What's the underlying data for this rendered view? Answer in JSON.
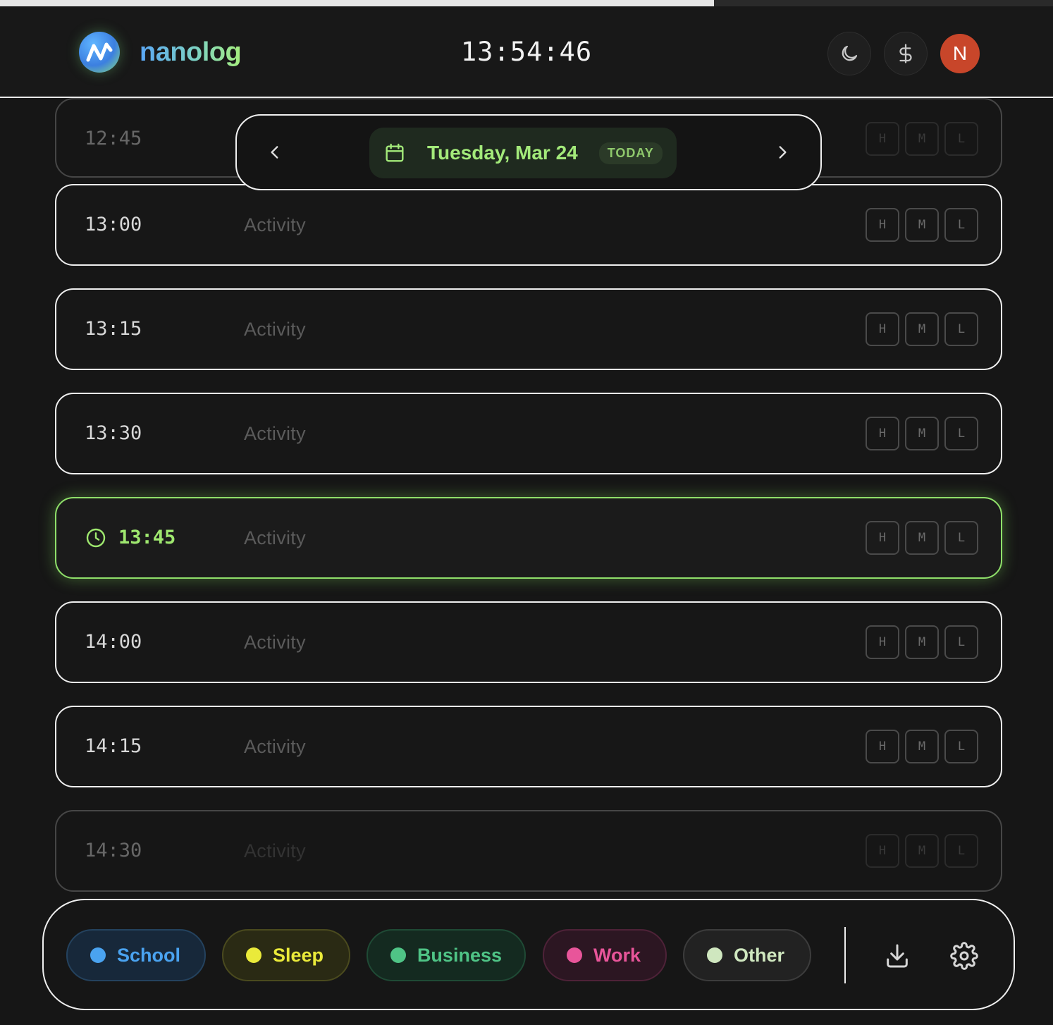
{
  "progress": {
    "fraction": 0.678
  },
  "header": {
    "brand": "nanolog",
    "clock": "13:54:46",
    "avatar_initial": "N"
  },
  "date_nav": {
    "date": "Tuesday, Mar 24",
    "badge": "TODAY"
  },
  "slots": [
    {
      "time": "12:45",
      "activity": "Activity",
      "levels": [
        "H",
        "M",
        "L"
      ],
      "state": "faded"
    },
    {
      "time": "13:00",
      "activity": "Activity",
      "levels": [
        "H",
        "M",
        "L"
      ],
      "state": "normal"
    },
    {
      "time": "13:15",
      "activity": "Activity",
      "levels": [
        "H",
        "M",
        "L"
      ],
      "state": "normal"
    },
    {
      "time": "13:30",
      "activity": "Activity",
      "levels": [
        "H",
        "M",
        "L"
      ],
      "state": "normal"
    },
    {
      "time": "13:45",
      "activity": "Activity",
      "levels": [
        "H",
        "M",
        "L"
      ],
      "state": "current"
    },
    {
      "time": "14:00",
      "activity": "Activity",
      "levels": [
        "H",
        "M",
        "L"
      ],
      "state": "normal"
    },
    {
      "time": "14:15",
      "activity": "Activity",
      "levels": [
        "H",
        "M",
        "L"
      ],
      "state": "normal"
    },
    {
      "time": "14:30",
      "activity": "Activity",
      "levels": [
        "H",
        "M",
        "L"
      ],
      "state": "faded"
    }
  ],
  "categories": [
    {
      "label": "School",
      "color": "#4aa3f0",
      "bg": "#17283a",
      "border": "#24425e"
    },
    {
      "label": "Sleep",
      "color": "#eaea3a",
      "bg": "#2a2a14",
      "border": "#4a4a1e"
    },
    {
      "label": "Business",
      "color": "#4fc486",
      "bg": "#142a20",
      "border": "#1f4a35"
    },
    {
      "label": "Work",
      "color": "#e8559a",
      "bg": "#2c1622",
      "border": "#4e2238"
    },
    {
      "label": "Other",
      "color": "#cfe7bf",
      "bg": "#222222",
      "border": "#3c3c3c"
    }
  ],
  "icons": {
    "theme": "moon-icon",
    "currency": "dollar-icon",
    "calendar": "calendar-icon",
    "current": "clock-icon",
    "export": "download-icon",
    "settings": "gear-icon"
  }
}
